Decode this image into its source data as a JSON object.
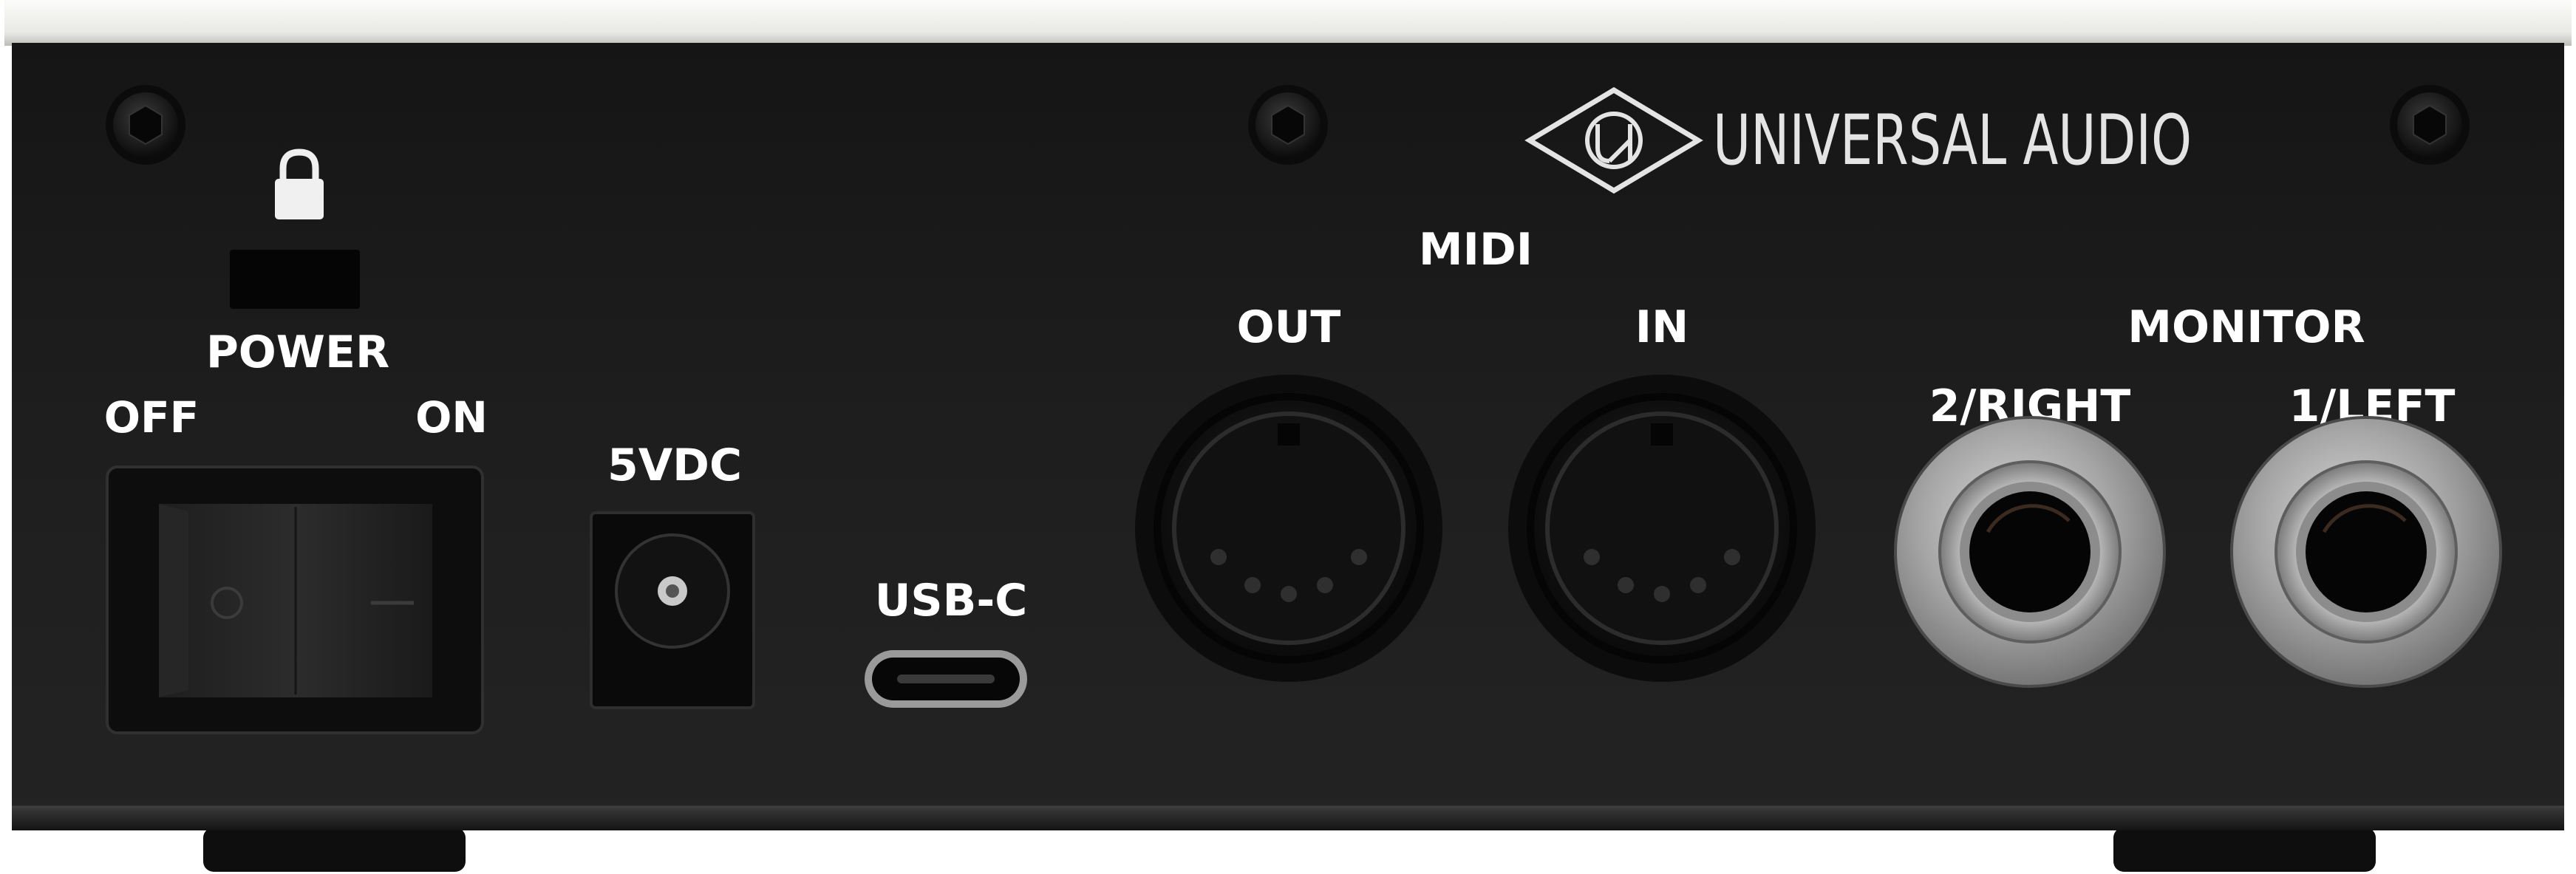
{
  "brand": {
    "name": "UNIVERSAL AUDIO",
    "logo_icon": "ua-diamond-logo-icon"
  },
  "power": {
    "title": "POWER",
    "off_label": "OFF",
    "on_label": "ON",
    "lock_icon": "padlock-icon",
    "switch_icon": "rocker-switch-icon"
  },
  "dc_input": {
    "label": "5VDC"
  },
  "usb": {
    "label": "USB-C"
  },
  "midi": {
    "title": "MIDI",
    "out_label": "OUT",
    "in_label": "IN",
    "connector_icon": "din-5-pin-icon"
  },
  "monitor": {
    "title": "MONITOR",
    "right_label": "2/RIGHT",
    "left_label": "1/LEFT",
    "connector_icon": "quarter-inch-jack-icon"
  },
  "colors": {
    "chassis": "#1c1c1c",
    "top_trim": "#efefec",
    "label_text": "#ffffff",
    "brand_text": "#e4e4e4",
    "jack_metal": "#a9a9a9"
  }
}
